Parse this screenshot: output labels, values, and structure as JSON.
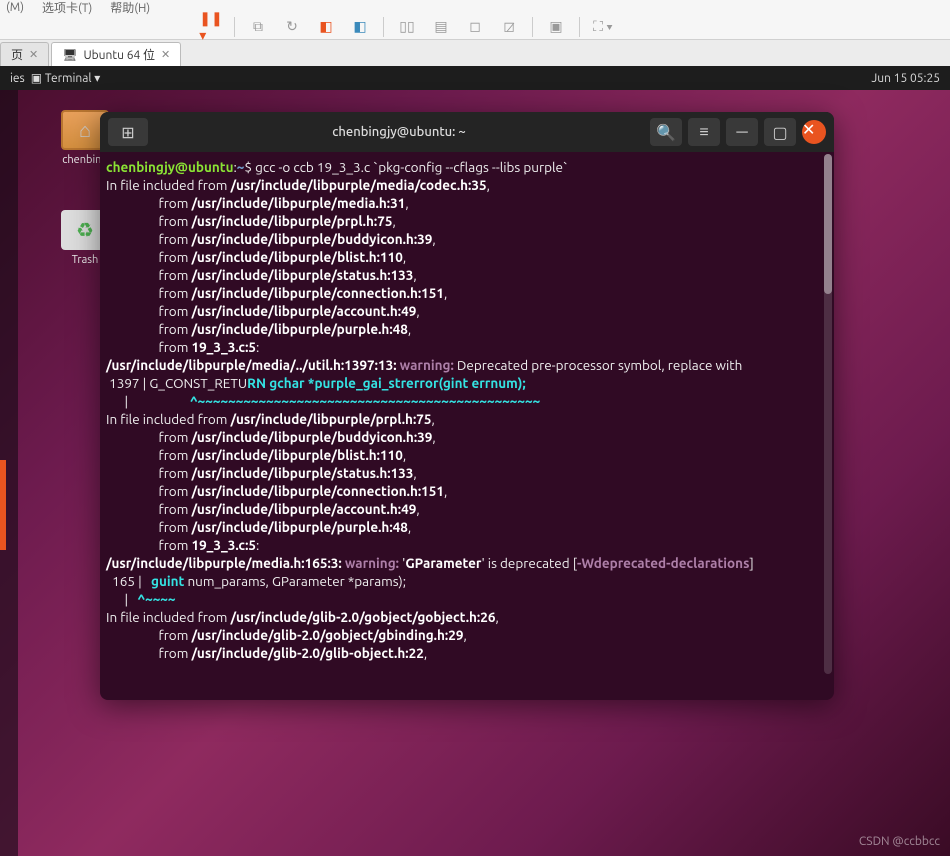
{
  "host_menu": {
    "view": "(M)",
    "options": "选项卡(T)",
    "help": "帮助(H)"
  },
  "tabs": {
    "t0": "页",
    "t1_icon": "🖥",
    "t1": "Ubuntu 64 位"
  },
  "topbar": {
    "activities": "ies",
    "terminal": "Terminal",
    "clock": "Jun 15  05:25"
  },
  "desktop": {
    "home": "chenbing",
    "trash": "Trash"
  },
  "term": {
    "title": "chenbingjy@ubuntu: ~",
    "user": "chenbingjy@ubuntu",
    "tilde": "~",
    "prompt": "$",
    "cmd": " gcc -o ccb 19_3_3.c `pkg-config --cflags --libs purple`",
    "l1a": "In file included from ",
    "p1": "/usr/include/libpurple/media/codec.h:35",
    "c1": ",",
    "from": "                 from ",
    "p2": "/usr/include/libpurple/media.h:31",
    "c2": ",",
    "p3": "/usr/include/libpurple/prpl.h:75",
    "c3": ",",
    "p4": "/usr/include/libpurple/buddyicon.h:39",
    "c4": ",",
    "p5": "/usr/include/libpurple/blist.h:110",
    "c5": ",",
    "p6": "/usr/include/libpurple/status.h:133",
    "c6": ",",
    "p7": "/usr/include/libpurple/connection.h:151",
    "c7": ",",
    "p8": "/usr/include/libpurple/account.h:49",
    "c8": ",",
    "p9": "/usr/include/libpurple/purple.h:48",
    "c9": ",",
    "p10": "19_3_3.c:5",
    "c10": ":",
    "w1a": "/usr/include/libpurple/media/../util.h:1397:13:",
    "w1s": " ",
    "w1b": "warning:",
    "w1c": " Deprecated pre-processor symbol, replace with",
    "ln1": " 1397 | G_CONST_RETU",
    "ln1b": "RN gchar *purple_gai_strerror(gint errnum);",
    "ln1c": "      |                    ",
    "ln1d": "^~~~~~~~~~~~~~~~~~~~~~~~~~~~~~~~~~~~~~~~~~~~~~",
    "l2a": "In file included from ",
    "p11": "/usr/include/libpurple/prpl.h:75",
    "c11": ",",
    "p12": "/usr/include/libpurple/buddyicon.h:39",
    "c12": ",",
    "p13": "/usr/include/libpurple/blist.h:110",
    "c13": ",",
    "p14": "/usr/include/libpurple/status.h:133",
    "c14": ",",
    "p15": "/usr/include/libpurple/connection.h:151",
    "c15": ",",
    "p16": "/usr/include/libpurple/account.h:49",
    "c16": ",",
    "p17": "/usr/include/libpurple/purple.h:48",
    "c17": ",",
    "p18": "19_3_3.c:5",
    "c18": ":",
    "w2a": "/usr/include/libpurple/media.h:165:3:",
    "w2s": " ",
    "w2b": "warning:",
    "w2c": " '",
    "w2d": "GParameter",
    "w2e": "' is deprecated [",
    "w2f": "-Wdeprecated-declarations",
    "w2g": "]",
    "ln2": "  165 |   ",
    "ln2b": "guint",
    "ln2c": " num_params, GParameter *params);",
    "ln2d": "      |   ",
    "ln2e": "^~~~~",
    "l3a": "In file included from ",
    "p19": "/usr/include/glib-2.0/gobject/gobject.h:26",
    "c19": ",",
    "p20": "/usr/include/glib-2.0/gobject/gbinding.h:29",
    "c20": ",",
    "p21": "/usr/include/glib-2.0/glib-object.h:22",
    "c21": ","
  },
  "watermark": "CSDN @ccbbcc"
}
